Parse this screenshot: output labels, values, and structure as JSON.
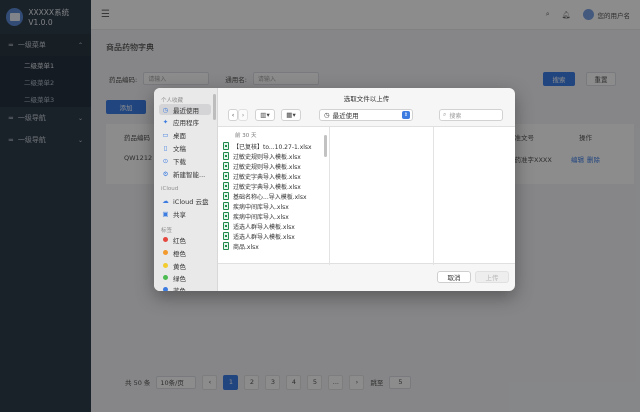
{
  "app": {
    "title": "XXXXX系统V1.0.0"
  },
  "sidebar": {
    "menus": [
      {
        "label": "一级菜单",
        "open": true,
        "items": [
          "二级菜单1",
          "二级菜单2",
          "二级菜单3"
        ]
      },
      {
        "label": "一级导航"
      },
      {
        "label": "一级导航"
      }
    ]
  },
  "header": {
    "user_name": "您的用户名"
  },
  "page": {
    "title": "商品药物字典",
    "filter": {
      "code_label": "药品编码:",
      "code_placeholder": "请输入",
      "name_label": "通用名:",
      "name_placeholder": "请输入"
    },
    "search_button": "搜索",
    "reset_button": "重置",
    "add_button": "添加",
    "table": {
      "headers": {
        "code": "药品编码",
        "approval": "批准文号",
        "actions": "操作"
      },
      "row": {
        "code": "QW1212",
        "approval": "国药准字XXXX",
        "edit": "编辑",
        "delete": "删除"
      }
    },
    "pager": {
      "total": "共 50 条",
      "page_size": "10条/页",
      "pages": [
        "1",
        "2",
        "3",
        "4",
        "5"
      ],
      "current": "1",
      "ellipsis": "...",
      "jump_label": "跳至",
      "jump_value": "5"
    }
  },
  "dialog": {
    "title": "选取文件以上传",
    "sidebar": {
      "personal_heading": "个人收藏",
      "personal": [
        {
          "label": "最近使用",
          "icon": "clock-icon",
          "glyph": "◷"
        },
        {
          "label": "应用程序",
          "icon": "apps-icon",
          "glyph": "✦"
        },
        {
          "label": "桌面",
          "icon": "desktop-icon",
          "glyph": "▭"
        },
        {
          "label": "文稿",
          "icon": "document-icon",
          "glyph": "▯"
        },
        {
          "label": "下载",
          "icon": "download-icon",
          "glyph": "⊙"
        },
        {
          "label": "新建智能...",
          "icon": "folder-icon",
          "glyph": "⚙"
        }
      ],
      "icloud_heading": "iCloud",
      "icloud": [
        {
          "label": "iCloud 云盘",
          "icon": "cloud-icon",
          "glyph": "☁"
        },
        {
          "label": "共享",
          "icon": "shared-folder-icon",
          "glyph": "▣"
        }
      ],
      "tags_heading": "标签",
      "tags": [
        {
          "label": "红色",
          "color": "#e5483f"
        },
        {
          "label": "橙色",
          "color": "#f29a2e"
        },
        {
          "label": "黄色",
          "color": "#f3cc2f"
        },
        {
          "label": "绿色",
          "color": "#4cbb52"
        },
        {
          "label": "蓝色",
          "color": "#3c7ce0"
        }
      ]
    },
    "toolbar": {
      "back": "‹",
      "forward": "›",
      "location": "最近使用",
      "search_placeholder": "搜索"
    },
    "group_label": "前 30 天",
    "files": [
      "【已复核】to...10.27-1.xlsx",
      "过敏史规则导入模板.xlsx",
      "过敏史规则导入模板.xlsx",
      "过敏史字典导入模板.xlsx",
      "过敏史字典导入模板.xlsx",
      "基础名称心...导入模板.xlsx",
      "疾病中间库导入.xlsx",
      "疾病中间库导入.xlsx",
      "适选人群导入模板.xlsx",
      "适选人群导入模板.xlsx",
      "商品.xlsx"
    ],
    "cancel_button": "取消",
    "upload_button": "上传"
  }
}
